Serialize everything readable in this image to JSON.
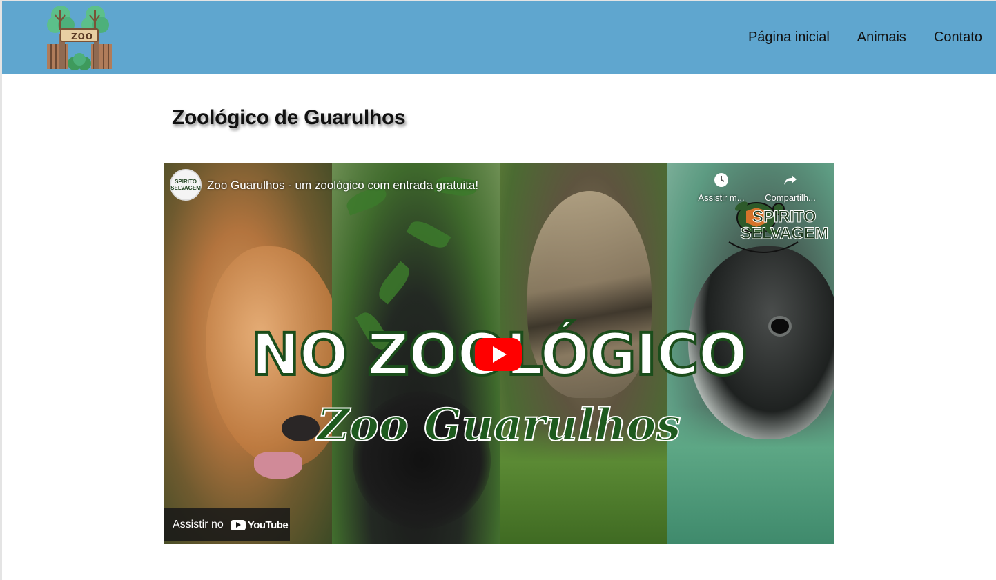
{
  "header": {
    "logo_text": "ZOO",
    "nav": [
      {
        "label": "Página inicial"
      },
      {
        "label": "Animais"
      },
      {
        "label": "Contato"
      }
    ],
    "bg_color": "#5fa6cf"
  },
  "main": {
    "title": "Zoológico de Guarulhos"
  },
  "video": {
    "title": "Zoo Guarulhos - um zoológico com entrada gratuita!",
    "channel_logo_text": "SPIRITO SELVAGEM",
    "watch_later_label": "Assistir m...",
    "share_label": "Compartilh...",
    "brand_line1": "SPIRITO",
    "brand_line2": "SELVAGEM",
    "headline": "NO ZOOLÓGICO",
    "subheadline": "Zoo Guarulhos",
    "watch_on_label": "Assistir no",
    "youtube_word": "YouTube",
    "play_color": "#ff0000"
  }
}
